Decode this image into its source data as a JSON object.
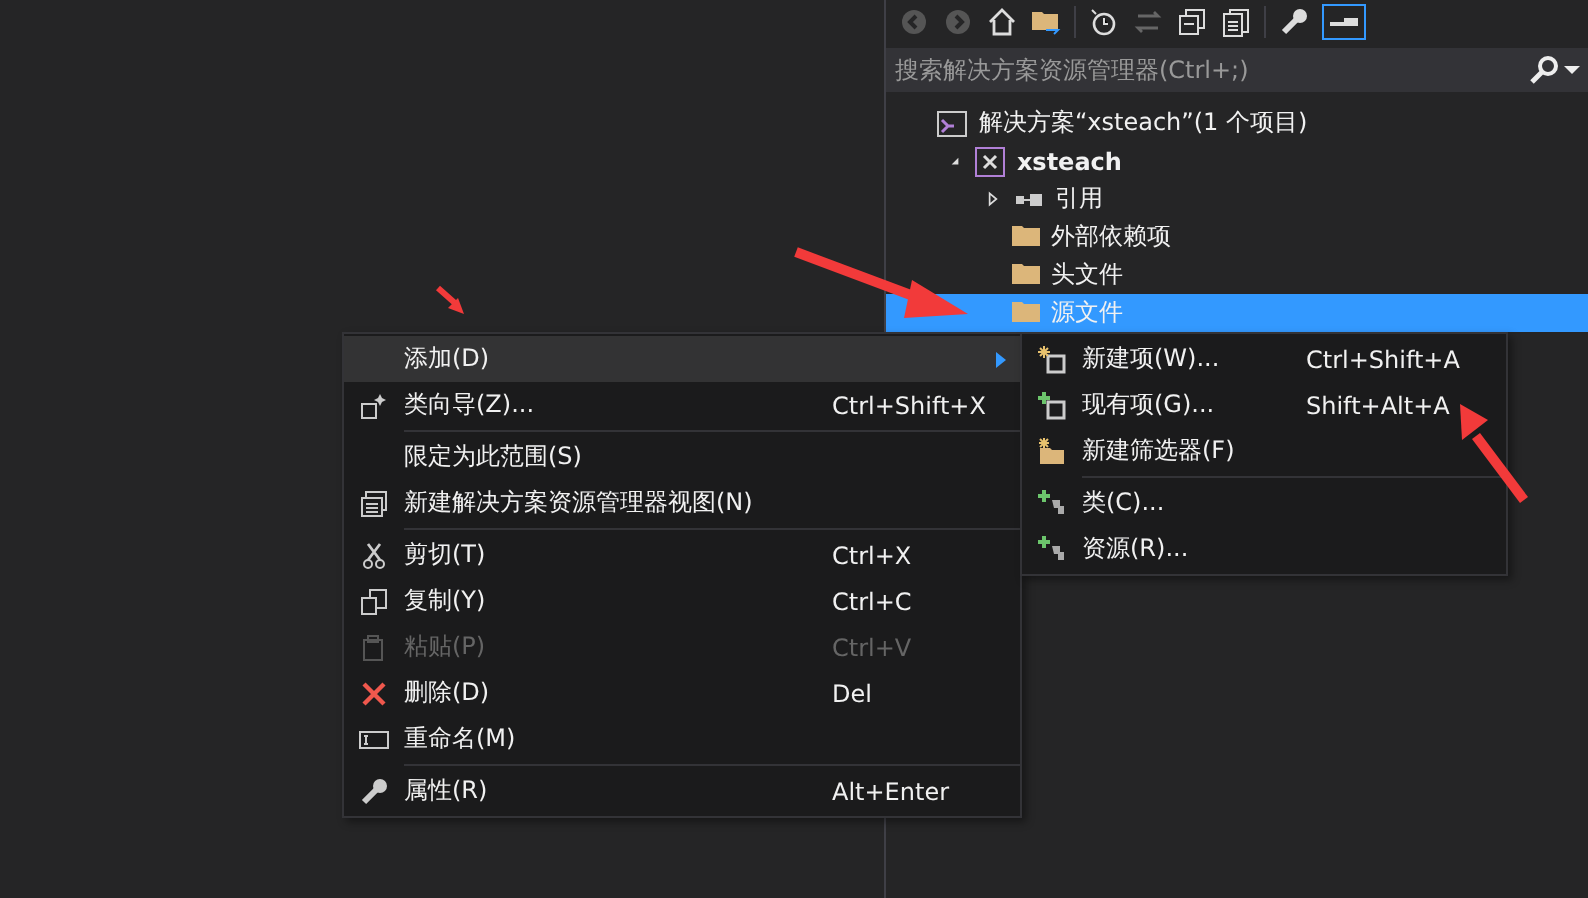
{
  "solution_explorer": {
    "search": {
      "placeholder": "搜索解决方案资源管理器(Ctrl+;)"
    },
    "tree": [
      {
        "label": "解决方案“xsteach”(1 个项目)",
        "selected": false,
        "children": [
          {
            "label": "xsteach",
            "selected": false,
            "expanded": true,
            "children": [
              {
                "label": "引用",
                "selected": false,
                "expanded": false
              },
              {
                "label": "外部依赖项",
                "selected": false
              },
              {
                "label": "头文件",
                "selected": false
              },
              {
                "label": "源文件",
                "selected": true
              }
            ]
          }
        ]
      }
    ]
  },
  "context_menu": {
    "groups": [
      [
        {
          "label": "添加(D)",
          "selected": true,
          "disabled": false,
          "submenu": true
        },
        {
          "label": "类向导(Z)...",
          "shortcut": "Ctrl+Shift+X",
          "selected": false,
          "disabled": false,
          "submenu": false
        }
      ],
      [
        {
          "label": "限定为此范围(S)",
          "selected": false,
          "disabled": false,
          "submenu": false
        },
        {
          "label": "新建解决方案资源管理器视图(N)",
          "selected": false,
          "disabled": false,
          "submenu": false
        }
      ],
      [
        {
          "label": "剪切(T)",
          "shortcut": "Ctrl+X",
          "selected": false,
          "disabled": false,
          "submenu": false
        },
        {
          "label": "复制(Y)",
          "shortcut": "Ctrl+C",
          "selected": false,
          "disabled": false,
          "submenu": false
        },
        {
          "label": "粘贴(P)",
          "shortcut": "Ctrl+V",
          "selected": false,
          "disabled": true,
          "submenu": false
        },
        {
          "label": "删除(D)",
          "shortcut": "Del",
          "selected": false,
          "disabled": false,
          "submenu": false
        },
        {
          "label": "重命名(M)",
          "selected": false,
          "disabled": false,
          "submenu": false
        }
      ],
      [
        {
          "label": "属性(R)",
          "shortcut": "Alt+Enter",
          "selected": false,
          "disabled": false,
          "submenu": false
        }
      ]
    ]
  },
  "submenu": {
    "groups": [
      [
        {
          "label": "新建项(W)...",
          "shortcut": "Ctrl+Shift+A"
        },
        {
          "label": "现有项(G)...",
          "shortcut": "Shift+Alt+A"
        },
        {
          "label": "新建筛选器(F)"
        }
      ],
      [
        {
          "label": "类(C)..."
        },
        {
          "label": "资源(R)..."
        }
      ]
    ]
  }
}
